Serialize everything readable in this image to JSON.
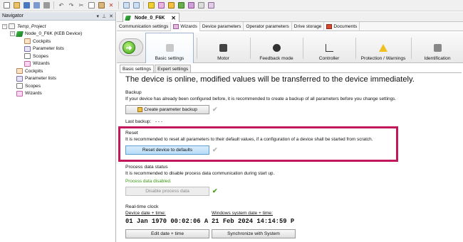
{
  "toolbar": {
    "icons": [
      "new-project-icon",
      "open-icon",
      "save-icon",
      "save-all-icon",
      "print-icon",
      "undo-icon",
      "redo-icon",
      "cut-icon",
      "copy-icon",
      "paste-icon",
      "delete-icon",
      "find-icon",
      "find-next-icon",
      "connect-icon",
      "disconnect-icon",
      "device-icon",
      "scan-icon",
      "update-icon",
      "grid-icon",
      "settings-icon"
    ]
  },
  "navigator": {
    "title": "Navigator",
    "controls": [
      "▾",
      "⊥",
      "✕"
    ],
    "tree": [
      {
        "label": "Temp_Project",
        "level": 0,
        "icon": "project-icon",
        "italic": true,
        "expander": "−"
      },
      {
        "label": "Node_0_F6K (KEB Device)",
        "level": 1,
        "icon": "device-icon",
        "expander": "−"
      },
      {
        "label": "Cockpits",
        "level": 2,
        "icon": "cockpit-icon"
      },
      {
        "label": "Parameter lists",
        "level": 2,
        "icon": "parameter-list-icon"
      },
      {
        "label": "Scopes",
        "level": 2,
        "icon": "scope-icon"
      },
      {
        "label": "Wizards",
        "level": 2,
        "icon": "wizard-icon"
      },
      {
        "label": "Cockpits",
        "level": 1,
        "icon": "cockpit-icon"
      },
      {
        "label": "Parameter lists",
        "level": 1,
        "icon": "parameter-list-icon"
      },
      {
        "label": "Scopes",
        "level": 1,
        "icon": "scope-icon"
      },
      {
        "label": "Wizards",
        "level": 1,
        "icon": "wizard-icon"
      }
    ]
  },
  "document": {
    "tab_title": "Node_0_F6K",
    "close": "✕"
  },
  "sub_tabs": [
    {
      "label": "Communication settings",
      "active": false
    },
    {
      "label": "Wizards",
      "active": true
    },
    {
      "label": "Device parameters",
      "active": false
    },
    {
      "label": "Operator parameters",
      "active": false
    },
    {
      "label": "Drive storage",
      "active": false
    },
    {
      "label": "Documents",
      "active": false
    }
  ],
  "wizard_steps": [
    {
      "label": "Basic settings",
      "active": true
    },
    {
      "label": "Motor",
      "active": false
    },
    {
      "label": "Feedback mode",
      "active": false
    },
    {
      "label": "Controller",
      "active": false
    },
    {
      "label": "Protection / Warnings",
      "active": false
    },
    {
      "label": "Identification",
      "active": false
    }
  ],
  "content_tabs": [
    {
      "label": "Basic settings",
      "active": true
    },
    {
      "label": "Expert settings",
      "active": false
    }
  ],
  "status_message": "The device is online, modified  values will be transferred to the device immediately.",
  "backup": {
    "title": "Backup",
    "description": "If your device has already been configured before, it is recommended to create a backup of all parameters before you change settings.",
    "button": "Create parameter backup",
    "last_backup_label": "Last backup:",
    "last_backup_value": "- - -"
  },
  "reset": {
    "title": "Reset",
    "description": "It is recommended to reset all parameters to their default values, if a configuration of a device shall be started from scratch.",
    "button": "Reset device to defaults"
  },
  "process_data": {
    "title": "Process data status",
    "description": "It is recommended to disable process data communication during start up.",
    "status": "Process data disabled.",
    "button": "Disable process data"
  },
  "clock": {
    "title": "Real-time clock",
    "device_label": "Device date + time:",
    "device_value": "01 Jan 1970 00:02:06 A",
    "system_label": "Windows system date + time:",
    "system_value": "21 Feb 2024 14:14:59 P",
    "edit_button": "Edit date + time",
    "sync_button": "Synchronize with System"
  },
  "colors": {
    "highlight": "#c2185b",
    "status_ok": "#4aa01a"
  }
}
